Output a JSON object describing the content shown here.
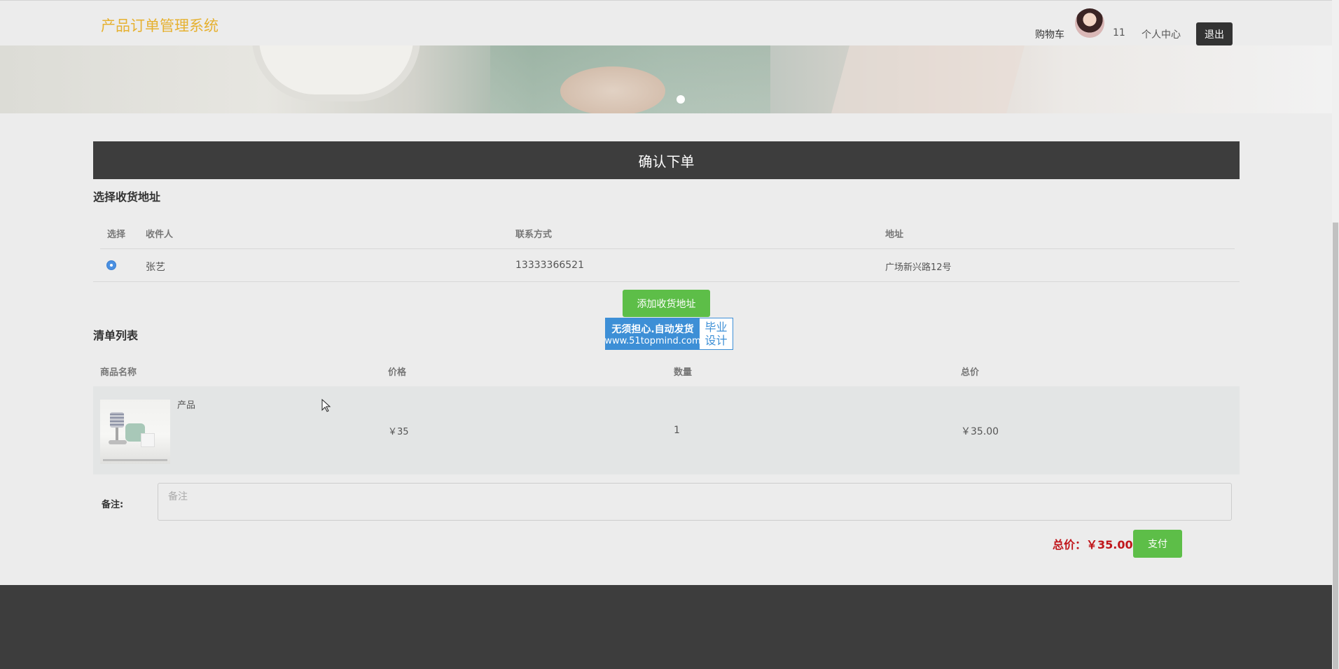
{
  "header": {
    "brand": "产品订单管理系统",
    "cart": "购物车",
    "count": "11",
    "user_center": "个人中心",
    "logout": "退出"
  },
  "page": {
    "confirm_title": "确认下单"
  },
  "address": {
    "section_title": "选择收货地址",
    "columns": [
      "选择",
      "收件人",
      "联系方式",
      "地址"
    ],
    "rows": [
      {
        "selected": true,
        "name": "张艺",
        "phone": "13333366521",
        "address": "广场新兴路12号"
      }
    ],
    "add_button": "添加收货地址"
  },
  "watermark": {
    "line1": "无须担心.自动发货",
    "line2": "www.51topmind.com",
    "right1": "毕业",
    "right2": "设计"
  },
  "items": {
    "section_title": "清单列表",
    "columns": [
      "商品名称",
      "价格",
      "数量",
      "总价"
    ],
    "rows": [
      {
        "name": "产品",
        "price": "￥35",
        "quantity": "1",
        "total": "￥35.00"
      }
    ]
  },
  "remark": {
    "label": "备注:",
    "placeholder": "备注",
    "value": ""
  },
  "summary": {
    "total_text": "总价：￥35.00",
    "pay_button": "支付"
  },
  "colors": {
    "brand": "#e6b130",
    "button_green": "#5dbe48",
    "dark_bar": "#3d3d3d",
    "total_red": "#c0151a"
  }
}
